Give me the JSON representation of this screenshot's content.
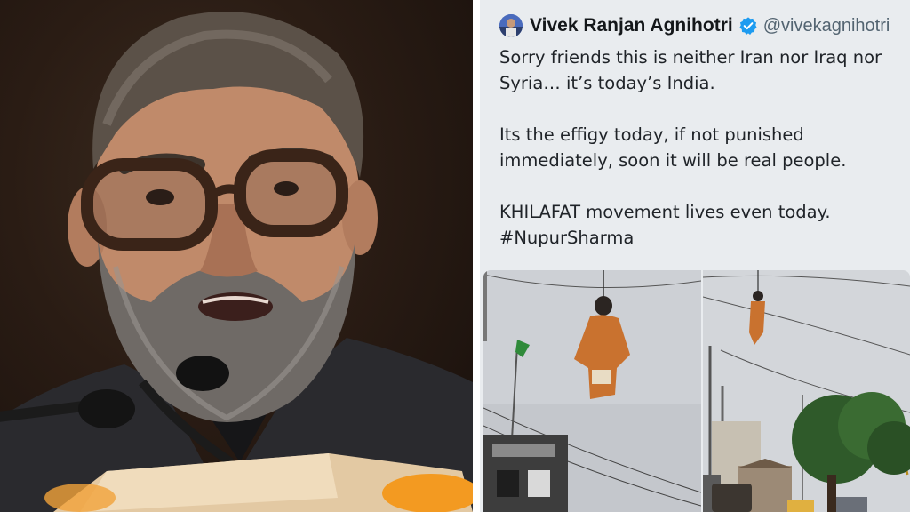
{
  "tweet": {
    "author": {
      "name": "Vivek Ranjan Agnihotri",
      "handle": "@vivekagnihotri",
      "verified": true,
      "verified_color": "#1d9bf0"
    },
    "text": {
      "p1": [
        "Sorry friends this is neither Iran nor Iraq nor",
        "Syria… it’s today’s India."
      ],
      "p2": [
        "Its the effigy today, if not punished",
        "immediately, soon it will be real people."
      ],
      "p3": [
        "KHILAFAT movement lives even today.",
        "#NupurSharma"
      ]
    },
    "media_count": 2
  },
  "colors": {
    "tweet_bg": "#e9ecef",
    "text": "#1f2328",
    "handle": "#536471",
    "sky": "#c9ccd1",
    "effigy": "#c9722f"
  }
}
